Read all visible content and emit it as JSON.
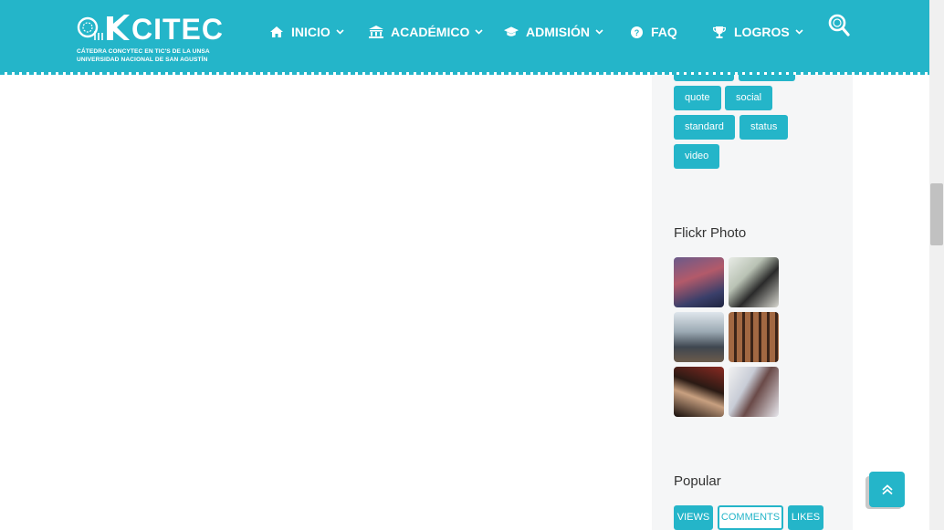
{
  "header": {
    "logo": {
      "title": "CITEC",
      "subtitle_line1": "CÁTEDRA CONCYTEC EN TIC'S DE LA UNSA",
      "subtitle_line2": "UNIVERSIDAD NACIONAL DE SAN AGUSTÍN"
    },
    "nav": [
      {
        "label": "INICIO",
        "icon": "home-icon",
        "has_dropdown": true
      },
      {
        "label": "ACADÉMICO",
        "icon": "bank-icon",
        "has_dropdown": true
      },
      {
        "label": "ADMISIÓN",
        "icon": "graduation-cap-icon",
        "has_dropdown": true
      },
      {
        "label": "FAQ",
        "icon": "question-circle-icon",
        "has_dropdown": false
      },
      {
        "label": "LOGROS",
        "icon": "trophy-icon",
        "has_dropdown": true
      }
    ],
    "search_icon": "search-icon"
  },
  "sidebar": {
    "tags": [
      "quote",
      "social",
      "standard",
      "status",
      "video"
    ],
    "flickr_title": "Flickr Photo",
    "flickr_photos": [
      {
        "name": "flickr-photo-1"
      },
      {
        "name": "flickr-photo-2"
      },
      {
        "name": "flickr-photo-3"
      },
      {
        "name": "flickr-photo-4"
      },
      {
        "name": "flickr-photo-5"
      },
      {
        "name": "flickr-photo-6"
      }
    ],
    "popular_title": "Popular",
    "popular_tabs": [
      "VIEWS",
      "COMMENTS",
      "LIKES"
    ]
  },
  "colors": {
    "accent": "#24b5c9",
    "sidebar_bg": "#f5f6f7"
  }
}
